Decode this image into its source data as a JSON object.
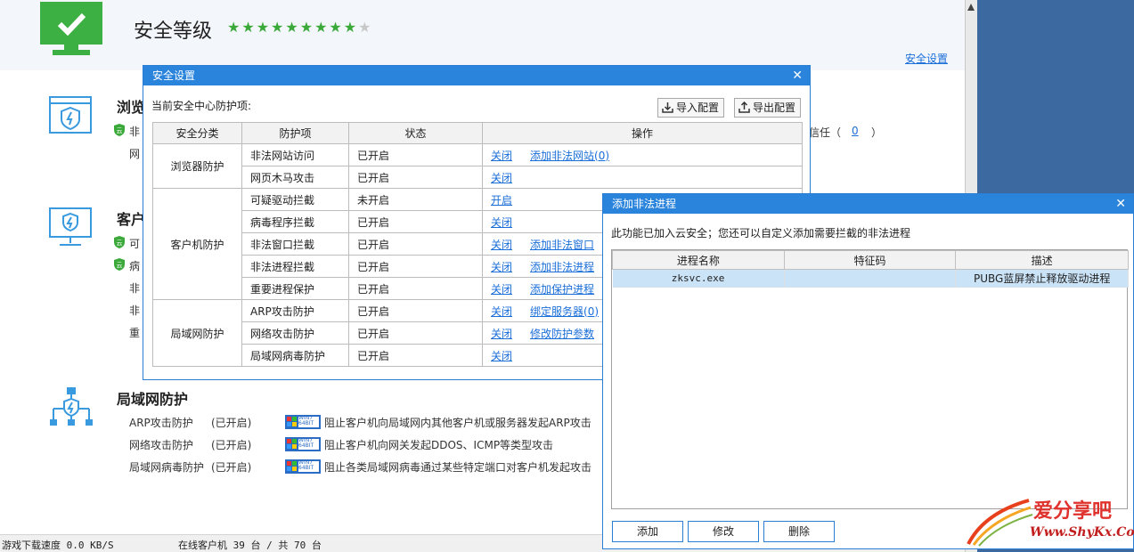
{
  "header": {
    "title": "安全等级",
    "stars_on": 9,
    "stars_total": 10,
    "settings_link": "安全设置"
  },
  "bg": {
    "browser_heading": "浏览",
    "client_heading": "客户",
    "partial_texts": [
      "非",
      "网",
      "可",
      "病",
      "非",
      "非",
      "重"
    ],
    "trust_text": "信任（",
    "trust_count": "0",
    "trust_close": "）",
    "lan_heading": "局域网防护",
    "lan_items": [
      {
        "name": "ARP攻击防护",
        "status": "(已开启)",
        "badge": "WIN7 64BIT",
        "desc": "阻止客户机向局域网内其他客户机或服务器发起ARP攻击"
      },
      {
        "name": "网络攻击防护",
        "status": "(已开启)",
        "badge": "WIN7 64BIT",
        "desc": "阻止客户机向网关发起DDOS、ICMP等类型攻击"
      },
      {
        "name": "局域网病毒防护",
        "status": "(已开启)",
        "badge": "WIN7 64BIT",
        "desc": "阻止各类局域网病毒通过某些特定端口对客户机发起攻击"
      }
    ]
  },
  "statusbar": {
    "speed": "游戏下载速度 0.0 KB/S",
    "online": "在线客户机 39 台 / 共 70 台"
  },
  "dialog1": {
    "title": "安全设置",
    "label": "当前安全中心防护项:",
    "import_btn": "导入配置",
    "export_btn": "导出配置",
    "columns": [
      "安全分类",
      "防护项",
      "状态",
      "操作"
    ],
    "groups": [
      {
        "category": "浏览器防护",
        "rows": [
          {
            "item": "非法网站访问",
            "status": "已开启",
            "action": "关闭",
            "extra": "添加非法网站(0)"
          },
          {
            "item": "网页木马攻击",
            "status": "已开启",
            "action": "关闭",
            "extra": ""
          }
        ]
      },
      {
        "category": "客户机防护",
        "rows": [
          {
            "item": "可疑驱动拦截",
            "status": "未开启",
            "action": "开启",
            "extra": ""
          },
          {
            "item": "病毒程序拦截",
            "status": "已开启",
            "action": "关闭",
            "extra": ""
          },
          {
            "item": "非法窗口拦截",
            "status": "已开启",
            "action": "关闭",
            "extra": "添加非法窗口"
          },
          {
            "item": "非法进程拦截",
            "status": "已开启",
            "action": "关闭",
            "extra": "添加非法进程"
          },
          {
            "item": "重要进程保护",
            "status": "已开启",
            "action": "关闭",
            "extra": "添加保护进程"
          }
        ]
      },
      {
        "category": "局域网防护",
        "rows": [
          {
            "item": "ARP攻击防护",
            "status": "已开启",
            "action": "关闭",
            "extra": "绑定服务器(0)"
          },
          {
            "item": "网络攻击防护",
            "status": "已开启",
            "action": "关闭",
            "extra": "修改防护参数"
          },
          {
            "item": "局域网病毒防护",
            "status": "已开启",
            "action": "关闭",
            "extra": ""
          }
        ]
      }
    ]
  },
  "dialog2": {
    "title": "添加非法进程",
    "desc": "此功能已加入云安全；您还可以自定义添加需要拦截的非法进程",
    "columns": [
      "进程名称",
      "特征码",
      "描述"
    ],
    "rows": [
      {
        "name": "zksvc.exe",
        "code": "",
        "desc": "PUBG蓝屏禁止释放驱动进程"
      }
    ],
    "add_btn": "添加",
    "edit_btn": "修改",
    "delete_btn": "删除"
  },
  "watermark": {
    "line1": "爱分享吧",
    "line2": "Www.ShyKx.Com"
  },
  "colors": {
    "accent": "#2a84dc",
    "link": "#1a6ed8",
    "green": "#3aa93a",
    "selected_row": "#cbe3f7"
  }
}
